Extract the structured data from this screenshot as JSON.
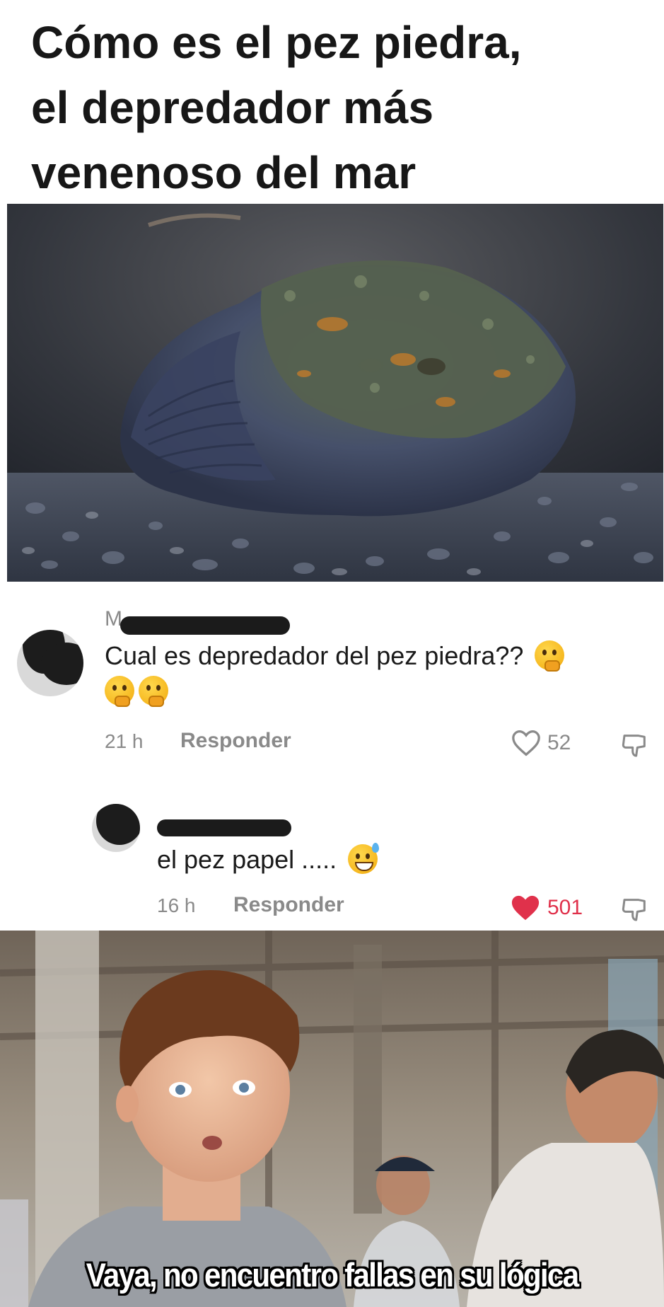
{
  "headline": {
    "line1": "Cómo es el pez piedra,",
    "line2": "el depredador más",
    "line3": "venenoso del mar"
  },
  "comments": [
    {
      "username_visible": "M",
      "text": "Cual es depredador del pez piedra??",
      "emojis": [
        "thinking-face",
        "thinking-face",
        "thinking-face"
      ],
      "time": "21 h",
      "reply_label": "Responder",
      "likes": "52",
      "liked": false
    },
    {
      "username_visible": "",
      "text": "el pez papel .....",
      "emojis": [
        "grinning-face-with-sweat"
      ],
      "time": "16 h",
      "reply_label": "Responder",
      "likes": "501",
      "liked": true
    }
  ],
  "meme": {
    "caption": "Vaya, no encuentro fallas en su lógica"
  },
  "colors": {
    "like_red": "#e0314b",
    "meta_gray": "#8a8a8a"
  }
}
